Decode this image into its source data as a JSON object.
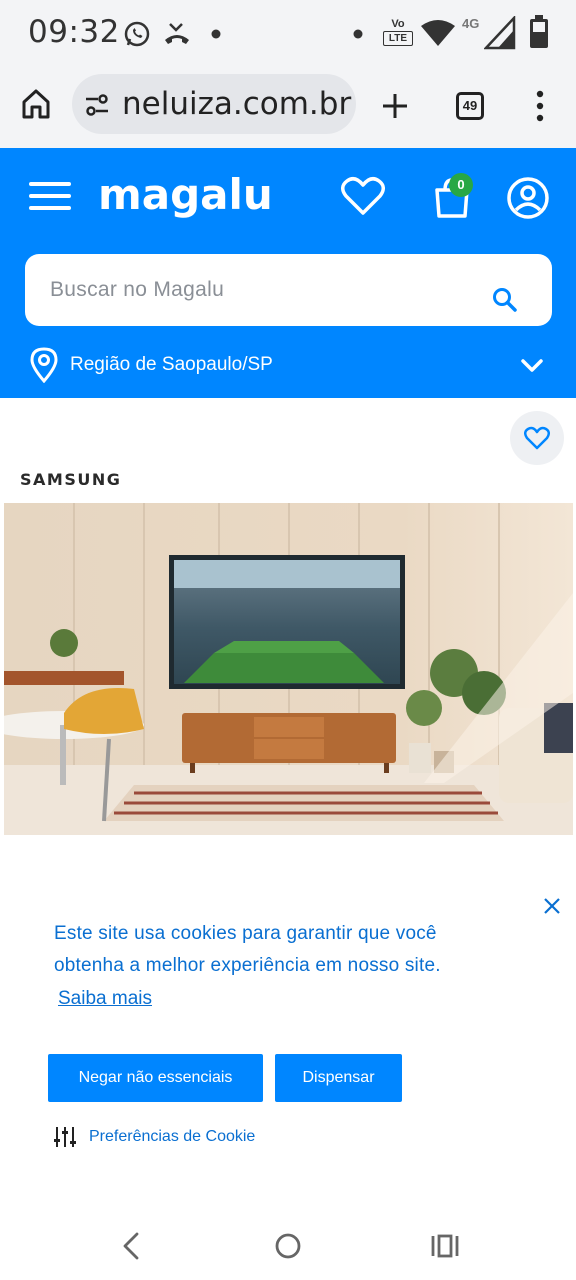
{
  "status_bar": {
    "time": "09:32",
    "icons": [
      "whatsapp-icon",
      "missed-call-icon",
      "dot-icon",
      "dot-icon",
      "volte-icon",
      "wifi-icon",
      "signal-4g-icon",
      "battery-icon"
    ],
    "network_label": "4G",
    "volte_label_top": "Vo",
    "volte_label_bottom": "LTE"
  },
  "browser": {
    "url": "neluiza.com.br",
    "tabs_count": "49",
    "icons": [
      "home-icon",
      "site-settings-icon",
      "new-tab-icon",
      "tab-switcher-icon",
      "more-options-icon"
    ]
  },
  "header": {
    "logo": "magalu",
    "cart_count": "0",
    "search": {
      "placeholder": "Buscar no Magalu"
    },
    "region": "Região de Saopaulo/SP",
    "brand_color": "#0086ff"
  },
  "product": {
    "brand": "SAMSUNG",
    "image_alt": "TV in living room showing stadium"
  },
  "cookie_banner": {
    "message": "Este site usa cookies para garantir que você obtenha a melhor experiência em nosso site.",
    "learn_more": "Saiba mais",
    "deny_button": "Negar não essenciais",
    "dismiss_button": "Dispensar",
    "preferences": "Preferências de Cookie"
  },
  "nav_bar": {
    "icons": [
      "back-icon",
      "home-circle-icon",
      "recents-icon"
    ]
  }
}
